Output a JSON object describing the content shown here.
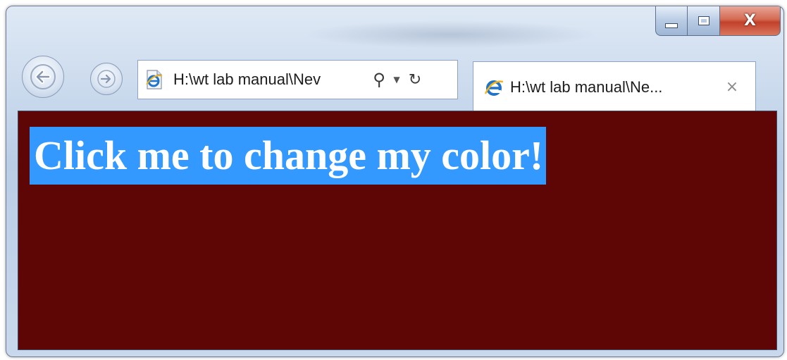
{
  "window": {
    "minimize_icon": "minimize-icon",
    "maximize_icon": "maximize-icon",
    "close_label": "X"
  },
  "nav": {
    "back_icon": "back-arrow-icon",
    "forward_icon": "forward-arrow-icon"
  },
  "address_bar": {
    "value": "H:\\wt lab manual\\Nev",
    "search_icon": "search-icon",
    "dropdown_icon": "dropdown-icon",
    "refresh_icon": "refresh-icon",
    "page_icon": "ie-page-icon"
  },
  "tab": {
    "title": "H:\\wt lab manual\\Ne...",
    "close_glyph": "×",
    "icon": "ie-logo-icon"
  },
  "content": {
    "heading": "Click me to change my color!",
    "background_color": "#5e0505",
    "highlight_color": "#3399ff",
    "text_color": "#ffffff"
  }
}
